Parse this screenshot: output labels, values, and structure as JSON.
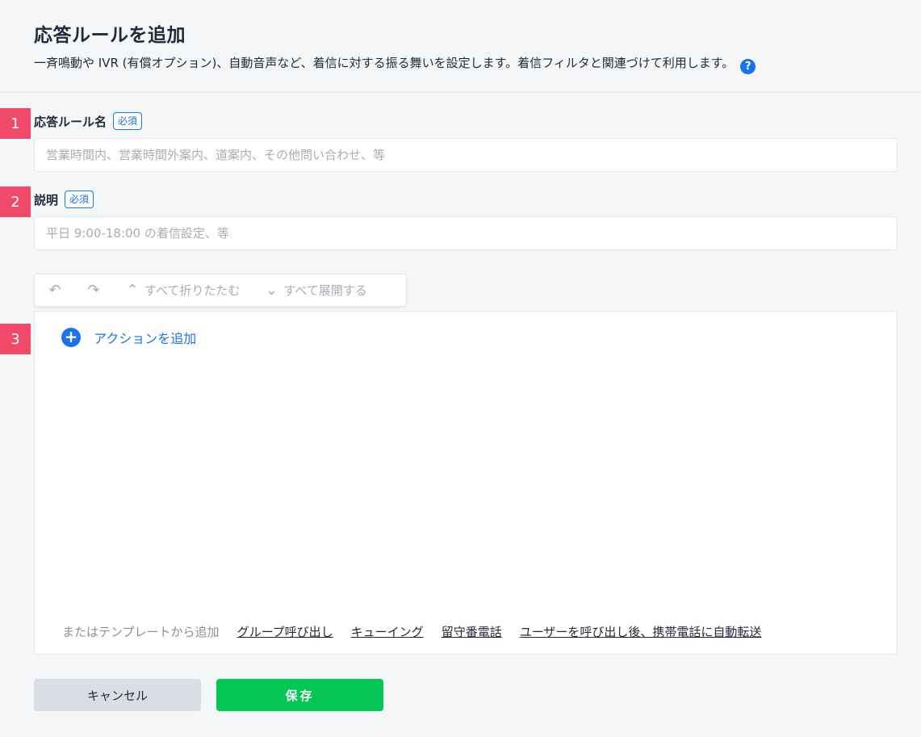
{
  "header": {
    "title": "応答ルールを追加",
    "description": "一斉鳴動や IVR (有償オプション)、自動音声など、着信に対する振る舞いを設定します。着信フィルタと関連づけて利用します。",
    "help_icon": "question-circle-icon",
    "help_glyph": "?"
  },
  "badges": [
    "1",
    "2",
    "3"
  ],
  "fields": {
    "rule_name": {
      "label": "応答ルール名",
      "required": "必須",
      "value": "",
      "placeholder": "営業時間内、営業時間外案内、道案内、その他問い合わせ、等"
    },
    "description": {
      "label": "説明",
      "required": "必須",
      "value": "",
      "placeholder": "平日 9:00-18:00 の着信設定、等"
    }
  },
  "toolbar": {
    "undo_icon": "undo-icon",
    "redo_icon": "redo-icon",
    "collapse_all": "すべて折りたたむ",
    "expand_all": "すべて展開する"
  },
  "actions": {
    "add_action": "アクションを追加",
    "template_prefix": "またはテンプレートから追加",
    "templates": [
      "グループ呼び出し",
      "キューイング",
      "留守番電話",
      "ユーザーを呼び出し後、携帯電話に自動転送"
    ]
  },
  "buttons": {
    "cancel": "キャンセル",
    "save": "保存"
  },
  "colors": {
    "accent": "#1a73e8",
    "badge": "#f0496a",
    "save": "#06c755",
    "cancel": "#d9dee5"
  }
}
